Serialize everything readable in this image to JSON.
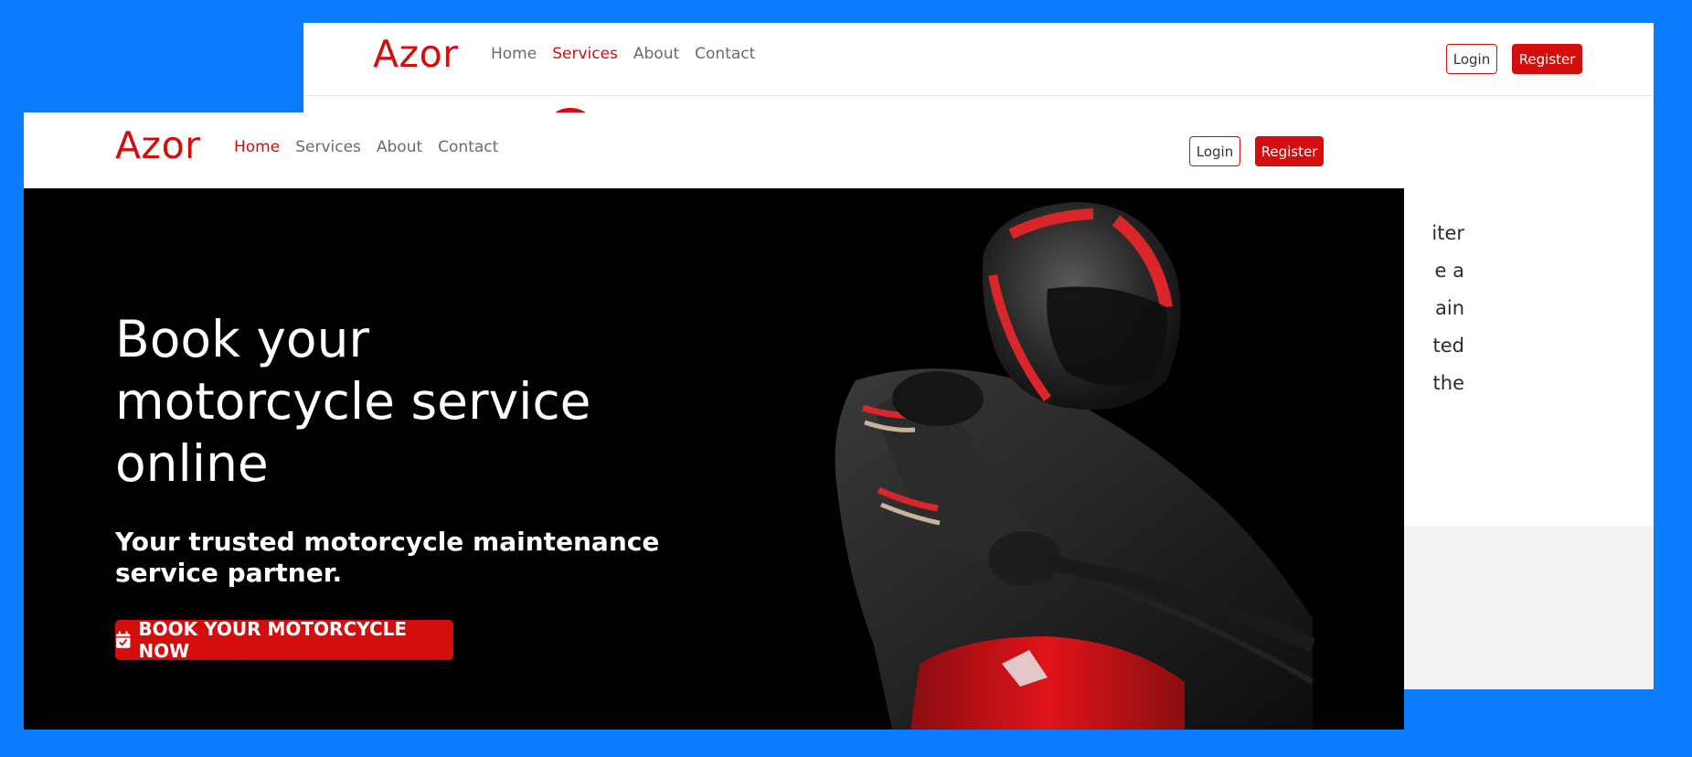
{
  "back_page": {
    "brand": "Azor",
    "nav": [
      "Home",
      "Services",
      "About",
      "Contact"
    ],
    "active_nav": "Services",
    "login_label": "Login",
    "register_label": "Register",
    "text_fragments": [
      "iter",
      "e a",
      "ain",
      "ted",
      "the"
    ]
  },
  "front_page": {
    "brand": "Azor",
    "nav": [
      "Home",
      "Services",
      "About",
      "Contact"
    ],
    "active_nav": "Home",
    "login_label": "Login",
    "register_label": "Register",
    "hero": {
      "title_lines": [
        "Book your",
        "motorcycle service",
        "online"
      ],
      "subtitle_lines": [
        "Your trusted motorcycle maintenance",
        "service partner."
      ],
      "cta_label": "BOOK YOUR MOTORCYCLE NOW",
      "cta_icon": "calendar-check-icon"
    },
    "image": "motorcycle-rider-helmet"
  },
  "colors": {
    "background": "#0a7bff",
    "brand_red": "#d40d0d",
    "hero_bg": "#000000",
    "nav_text": "#6b6b6b"
  }
}
